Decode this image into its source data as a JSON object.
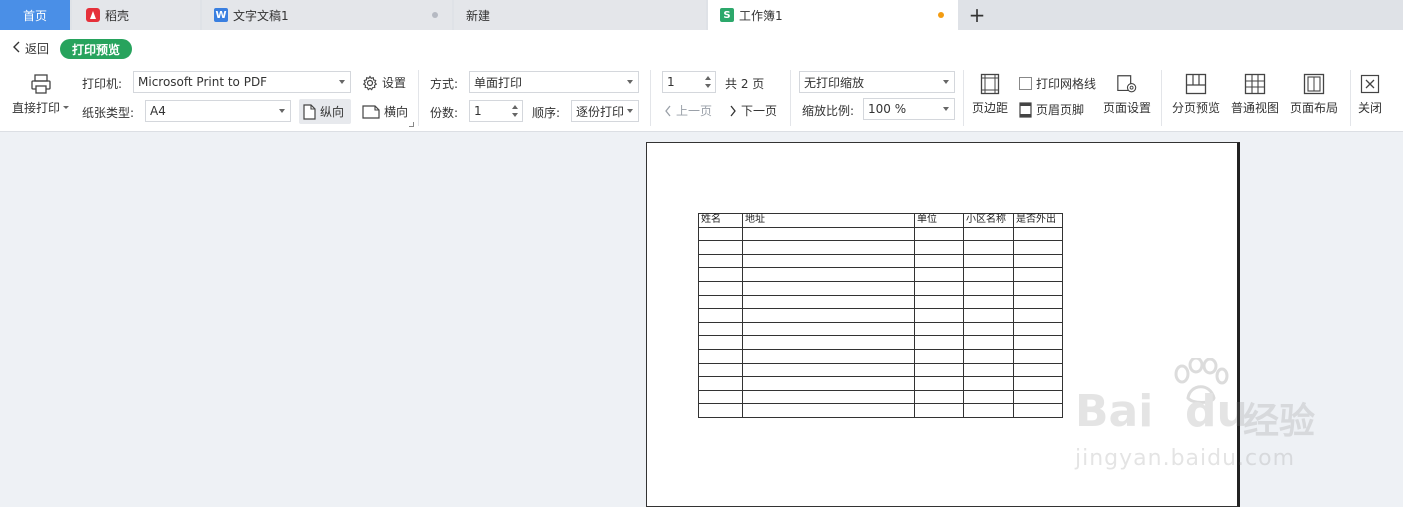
{
  "tabs": {
    "home": "首页",
    "daoke": "稻壳",
    "doc": "文字文稿1",
    "new": "新建",
    "book": "工作簿1",
    "add": "+"
  },
  "mode": {
    "back": "返回",
    "pill": "打印预览"
  },
  "print": {
    "direct_label": "直接打印",
    "printer_label": "打印机:",
    "printer_value": "Microsoft Print to PDF",
    "settings_label": "设置",
    "paper_label": "纸张类型:",
    "paper_value": "A4",
    "portrait_label": "纵向",
    "landscape_label": "横向"
  },
  "method": {
    "mode_label": "方式:",
    "mode_value": "单面打印",
    "copies_label": "份数:",
    "copies_value": "1",
    "order_label": "顺序:",
    "order_value": "逐份打印"
  },
  "pages": {
    "current": "1",
    "total_text": "共 2 页",
    "prev": "上一页",
    "next": "下一页"
  },
  "scale": {
    "mode_value": "无打印缩放",
    "ratio_label": "缩放比例:",
    "ratio_value": "100 %"
  },
  "tools": {
    "margins": "页边距",
    "gridlines": "打印网格线",
    "header_footer": "页眉页脚",
    "page_setup": "页面设置",
    "page_break": "分页预览",
    "normal_view": "普通视图",
    "page_layout": "页面布局",
    "close": "关闭"
  },
  "sheet": {
    "headers": [
      "姓名",
      "地址",
      "单位",
      "小区名称",
      "是否外出"
    ],
    "empty_rows": 14
  },
  "watermark": {
    "brand": "Bai",
    "brand2": "du",
    "cn": "经验",
    "url": "jingyan.baidu.com"
  },
  "colors": {
    "accent_green": "#27a35d",
    "home_tab_blue": "#4a8fe7",
    "unsaved_dot": "#f39c12"
  }
}
